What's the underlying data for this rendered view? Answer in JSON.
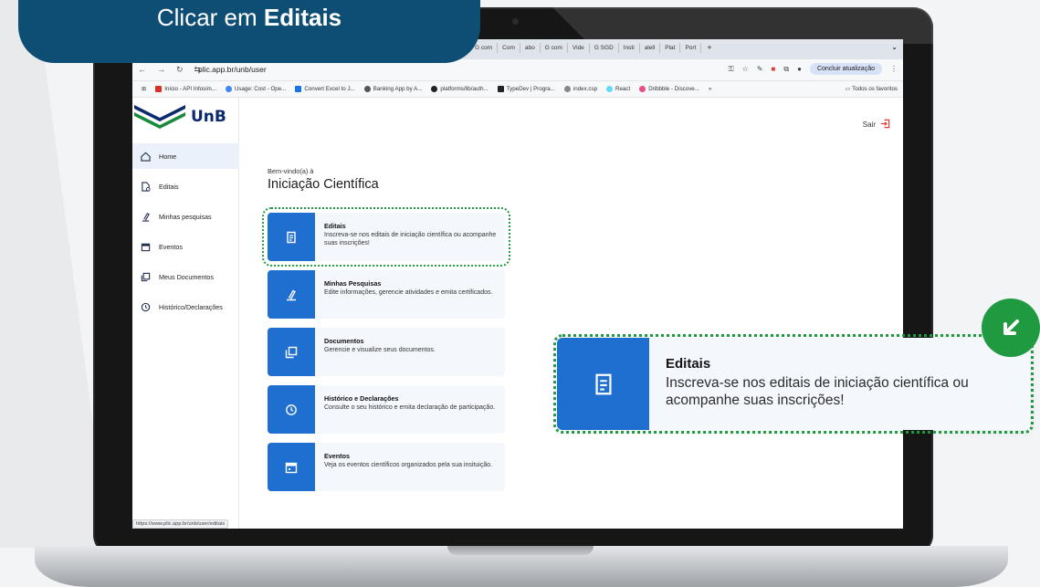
{
  "callout": {
    "prefix": "Clicar em ",
    "bold": "Editais"
  },
  "browser": {
    "tabs": [
      "G com",
      "Com",
      "abo",
      "G com",
      "Vide",
      "G SGD",
      "Insti",
      "alell",
      "Plat",
      "Port"
    ],
    "tab_new": "+",
    "url": "plic.app.br/unb/user",
    "update_button": "Concluir atualização",
    "bookmarks": [
      {
        "label": "Início - API Infosim...",
        "color": "#d93025"
      },
      {
        "label": "Usage: Cost - Ope...",
        "color": "#4285f4"
      },
      {
        "label": "Convert Excel to J...",
        "color": "#1a73e8"
      },
      {
        "label": "Banking App by A...",
        "color": "#555555"
      },
      {
        "label": "platforms/lib/auth...",
        "color": "#222222"
      },
      {
        "label": "TypeDev | Progra...",
        "color": "#222222"
      },
      {
        "label": "index.csp",
        "color": "#888888"
      },
      {
        "label": "React",
        "color": "#61dafb"
      },
      {
        "label": "Dribbble - Discove...",
        "color": "#ea4c89"
      }
    ],
    "bookmarks_more": "»",
    "all_favorites": "Todos os favoritos",
    "status_url": "https://www.plic.app.br/unb/user/editais"
  },
  "app": {
    "logo_text": "UnB",
    "logout_label": "Sair",
    "nav": [
      {
        "label": "Home",
        "icon": "home-icon",
        "active": true
      },
      {
        "label": "Editais",
        "icon": "document-icon"
      },
      {
        "label": "Minhas pesquisas",
        "icon": "research-icon"
      },
      {
        "label": "Eventos",
        "icon": "calendar-icon"
      },
      {
        "label": "Meus Documentos",
        "icon": "documents-icon"
      },
      {
        "label": "Histórico/Declarações",
        "icon": "history-icon"
      }
    ],
    "welcome": "Bem-vindo(a) à",
    "title": "Iniciação Científica",
    "cards": [
      {
        "title": "Editais",
        "desc": "Inscreva-se nos editais de iniciação científica ou acompanhe suas inscrições!",
        "icon": "document-icon"
      },
      {
        "title": "Minhas Pesquisas",
        "desc": "Edite informações, gerencie atividades e emita certificados.",
        "icon": "research-icon"
      },
      {
        "title": "Documentos",
        "desc": "Gerencie e visualize seus documentos.",
        "icon": "documents-icon"
      },
      {
        "title": "Histórico e Declarações",
        "desc": "Consulte o seu histórico e emita declaração de participação.",
        "icon": "history-icon"
      },
      {
        "title": "Eventos",
        "desc": "Veja os eventos científicos organizados pela sua insituição.",
        "icon": "calendar-icon"
      }
    ]
  },
  "zoom": {
    "title": "Editais",
    "desc": "Inscreva-se nos editais de iniciação científica ou acompanhe suas inscrições!"
  },
  "colors": {
    "brand_blue": "#1f6fd1",
    "callout_navy": "#0f4e74",
    "highlight_green": "#1f9a41",
    "logout_red": "#e53935"
  }
}
